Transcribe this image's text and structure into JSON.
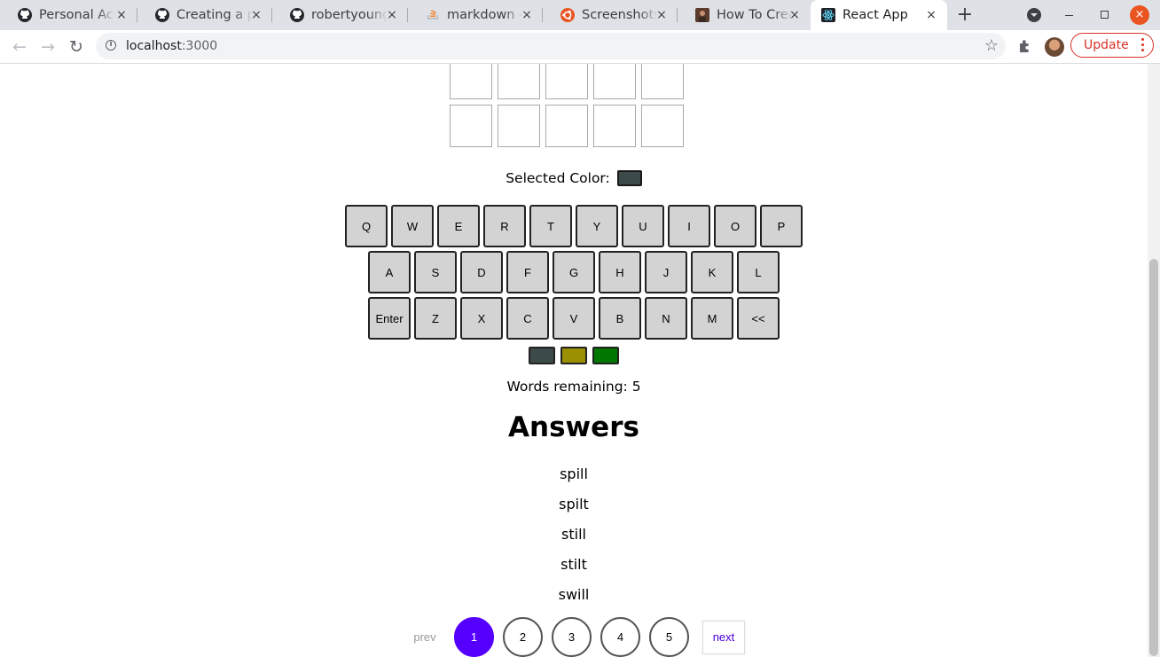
{
  "browser": {
    "tabs": [
      {
        "title": "Personal Acc",
        "icon": "github-icon"
      },
      {
        "title": "Creating a pe",
        "icon": "github-icon"
      },
      {
        "title": "robertyoung",
        "icon": "github-icon"
      },
      {
        "title": "markdown - I",
        "icon": "stackoverflow-icon"
      },
      {
        "title": "Screenshots",
        "icon": "ubuntu-icon"
      },
      {
        "title": "How To Crea",
        "icon": "article-icon"
      },
      {
        "title": "React App",
        "icon": "react-icon"
      }
    ],
    "url_host": "localhost",
    "url_port": ":3000",
    "update_label": "Update",
    "close_glyph": "×",
    "newtab_glyph": "+",
    "star_glyph": "☆"
  },
  "app": {
    "selected_color_label": "Selected Color:",
    "selected_color": "#3d4a4a",
    "keyboard": {
      "rows": [
        [
          "Q",
          "W",
          "E",
          "R",
          "T",
          "Y",
          "U",
          "I",
          "O",
          "P"
        ],
        [
          "A",
          "S",
          "D",
          "F",
          "G",
          "H",
          "J",
          "K",
          "L"
        ],
        [
          "Enter",
          "Z",
          "X",
          "C",
          "V",
          "B",
          "N",
          "M",
          "<<"
        ]
      ]
    },
    "color_options": [
      {
        "name": "gray",
        "color": "#3d4a4a"
      },
      {
        "name": "yellow",
        "color": "#9a9000"
      },
      {
        "name": "green",
        "color": "#007700"
      }
    ],
    "words_remaining": "Words remaining: 5",
    "answers_title": "Answers",
    "answers": [
      "spill",
      "spilt",
      "still",
      "stilt",
      "swill"
    ],
    "pagination": {
      "prev": "prev",
      "next": "next",
      "pages": [
        "1",
        "2",
        "3",
        "4",
        "5"
      ],
      "current": "1"
    }
  },
  "colors": {
    "accent": "#5500ff",
    "key_bg": "#d3d3d3",
    "update_red": "#d93025"
  }
}
